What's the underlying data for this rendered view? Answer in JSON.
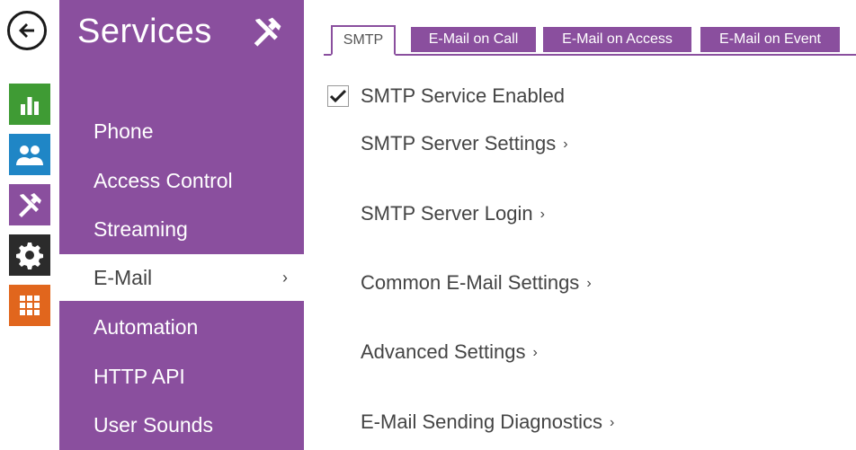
{
  "sidebar": {
    "title": "Services",
    "title_icon": "tools-icon",
    "items": [
      {
        "label": "Phone"
      },
      {
        "label": "Access Control"
      },
      {
        "label": "Streaming"
      },
      {
        "label": "E-Mail",
        "active": true,
        "chevron": "›"
      },
      {
        "label": "Automation"
      },
      {
        "label": "HTTP API"
      },
      {
        "label": "User Sounds"
      }
    ]
  },
  "rail": {
    "back_icon": "back-arrow-icon",
    "icons": [
      {
        "name": "chart-icon",
        "color": "#3f9b34"
      },
      {
        "name": "users-icon",
        "color": "#1f86c6"
      },
      {
        "name": "tools-icon",
        "color": "#8a4f9e"
      },
      {
        "name": "gear-icon",
        "color": "#2b2b2b"
      },
      {
        "name": "grid-icon",
        "color": "#e1661d"
      }
    ]
  },
  "tabs": [
    {
      "label": "SMTP",
      "active": true
    },
    {
      "label": "E-Mail on Call"
    },
    {
      "label": "E-Mail on Access"
    },
    {
      "label": "E-Mail on Event"
    }
  ],
  "main": {
    "smtp_enabled": {
      "label": "SMTP Service Enabled",
      "checked": true
    },
    "sections": [
      {
        "label": "SMTP Server Settings",
        "chevron": "›"
      },
      {
        "label": "SMTP Server Login",
        "chevron": "›"
      },
      {
        "label": "Common E-Mail Settings",
        "chevron": "›"
      },
      {
        "label": "Advanced Settings",
        "chevron": "›"
      },
      {
        "label": "E-Mail Sending Diagnostics",
        "chevron": "›"
      }
    ]
  },
  "colors": {
    "accent": "#8a4f9e",
    "text": "#444444"
  }
}
